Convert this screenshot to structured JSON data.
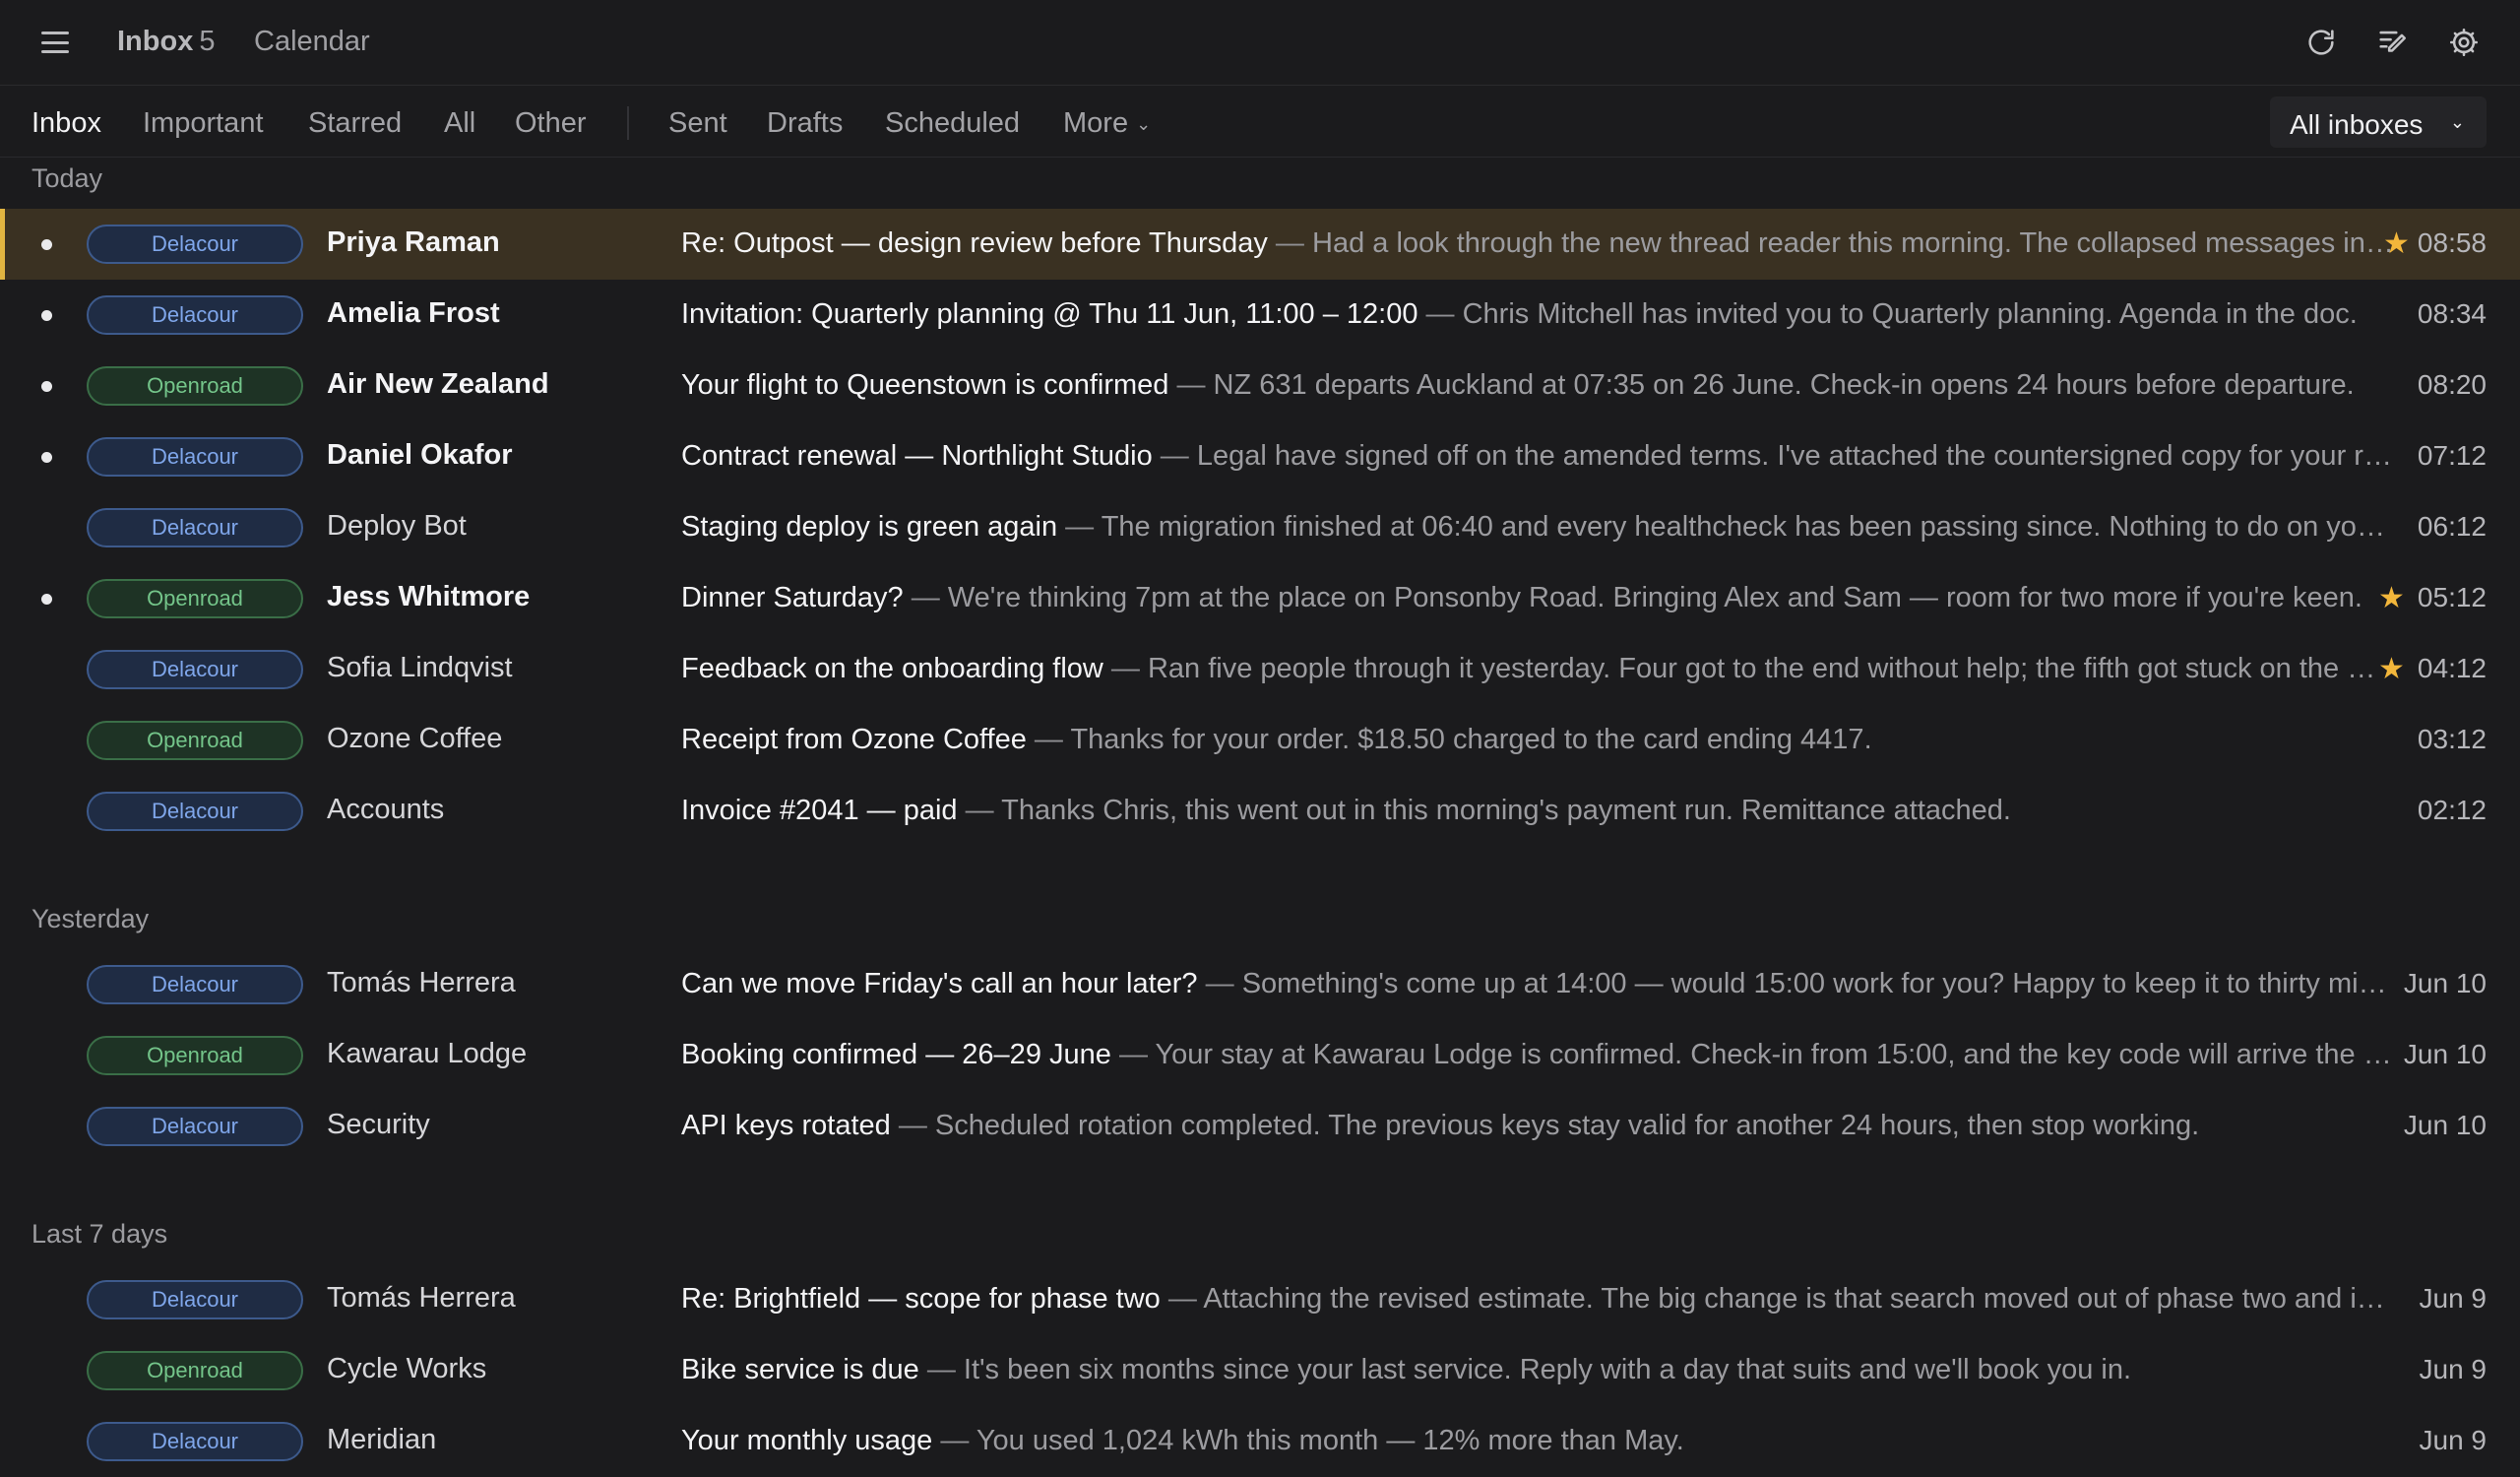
{
  "topbar": {
    "inbox_label": "Inbox",
    "inbox_count": "5",
    "calendar_label": "Calendar",
    "icons": [
      "menu-icon",
      "refresh-icon",
      "compose-icon",
      "settings-icon"
    ]
  },
  "nav": {
    "items": [
      "Inbox",
      "Important",
      "Starred",
      "All",
      "Other",
      "Sent",
      "Drafts",
      "Scheduled",
      "More"
    ],
    "active": "Inbox",
    "inbox_selector": "All inboxes"
  },
  "colors": {
    "accent_star": "#f2b63b",
    "selected_row": "#3a3122",
    "selected_border": "#e0b441",
    "tag_delacour": "#7fa6ea",
    "tag_openroad": "#74c58a"
  },
  "sections": [
    {
      "label": "Today",
      "rows": [
        {
          "tag": "Delacour",
          "sender": "Priya Raman",
          "subject": "Re: Outpost — design review before Thursday",
          "preview": "Had a look through the new thread reader this morning. The collapsed messages in the middle of a long thread are easy to miss.",
          "time": "08:58",
          "unread": true,
          "starred": true,
          "selected": true
        },
        {
          "tag": "Delacour",
          "sender": "Amelia Frost",
          "subject": "Invitation: Quarterly planning @ Thu 11 Jun, 11:00 – 12:00",
          "preview": "Chris Mitchell has invited you to Quarterly planning. Agenda in the doc.",
          "time": "08:34",
          "unread": true,
          "starred": false
        },
        {
          "tag": "Openroad",
          "sender": "Air New Zealand",
          "subject": "Your flight to Queenstown is confirmed",
          "preview": "NZ 631 departs Auckland at 07:35 on 26 June. Check-in opens 24 hours before departure.",
          "time": "08:20",
          "unread": true,
          "starred": false
        },
        {
          "tag": "Delacour",
          "sender": "Daniel Okafor",
          "subject": "Contract renewal — Northlight Studio",
          "preview": "Legal have signed off on the amended terms. I've attached the countersigned copy for your records.",
          "time": "07:12",
          "unread": true,
          "starred": false
        },
        {
          "tag": "Delacour",
          "sender": "Deploy Bot",
          "subject": "Staging deploy is green again",
          "preview": "The migration finished at 06:40 and every healthcheck has been passing since. Nothing to do on your end.",
          "time": "06:12",
          "unread": false,
          "starred": false
        },
        {
          "tag": "Openroad",
          "sender": "Jess Whitmore",
          "subject": "Dinner Saturday?",
          "preview": "We're thinking 7pm at the place on Ponsonby Road. Bringing Alex and Sam — room for two more if you're keen.",
          "time": "05:12",
          "unread": true,
          "starred": true
        },
        {
          "tag": "Delacour",
          "sender": "Sofia Lindqvist",
          "subject": "Feedback on the onboarding flow",
          "preview": "Ran five people through it yesterday. Four got to the end without help; the fifth got stuck on the workspace step.",
          "time": "04:12",
          "unread": false,
          "starred": true
        },
        {
          "tag": "Openroad",
          "sender": "Ozone Coffee",
          "subject": "Receipt from Ozone Coffee",
          "preview": "Thanks for your order. $18.50 charged to the card ending 4417.",
          "time": "03:12",
          "unread": false,
          "starred": false
        },
        {
          "tag": "Delacour",
          "sender": "Accounts",
          "subject": "Invoice #2041 — paid",
          "preview": "Thanks Chris, this went out in this morning's payment run. Remittance attached.",
          "time": "02:12",
          "unread": false,
          "starred": false
        }
      ]
    },
    {
      "label": "Yesterday",
      "rows": [
        {
          "tag": "Delacour",
          "sender": "Tomás Herrera",
          "subject": "Can we move Friday's call an hour later?",
          "preview": "Something's come up at 14:00 — would 15:00 work for you? Happy to keep it to thirty minutes.",
          "time": "Jun 10",
          "unread": false,
          "starred": false
        },
        {
          "tag": "Openroad",
          "sender": "Kawarau Lodge",
          "subject": "Booking confirmed — 26–29 June",
          "preview": "Your stay at Kawarau Lodge is confirmed. Check-in from 15:00, and the key code will arrive the day before.",
          "time": "Jun 10",
          "unread": false,
          "starred": false
        },
        {
          "tag": "Delacour",
          "sender": "Security",
          "subject": "API keys rotated",
          "preview": "Scheduled rotation completed. The previous keys stay valid for another 24 hours, then stop working.",
          "time": "Jun 10",
          "unread": false,
          "starred": false
        }
      ]
    },
    {
      "label": "Last 7 days",
      "rows": [
        {
          "tag": "Delacour",
          "sender": "Tomás Herrera",
          "subject": "Re: Brightfield — scope for phase two",
          "preview": "Attaching the revised estimate. The big change is that search moved out of phase two and into phase three.",
          "time": "Jun 9",
          "unread": false,
          "starred": false
        },
        {
          "tag": "Openroad",
          "sender": "Cycle Works",
          "subject": "Bike service is due",
          "preview": "It's been six months since your last service. Reply with a day that suits and we'll book you in.",
          "time": "Jun 9",
          "unread": false,
          "starred": false
        },
        {
          "tag": "Delacour",
          "sender": "Meridian",
          "subject": "Your monthly usage",
          "preview": "You used 1,024 kWh this month — 12% more than May.",
          "time": "Jun 9",
          "unread": false,
          "starred": false
        }
      ]
    }
  ]
}
